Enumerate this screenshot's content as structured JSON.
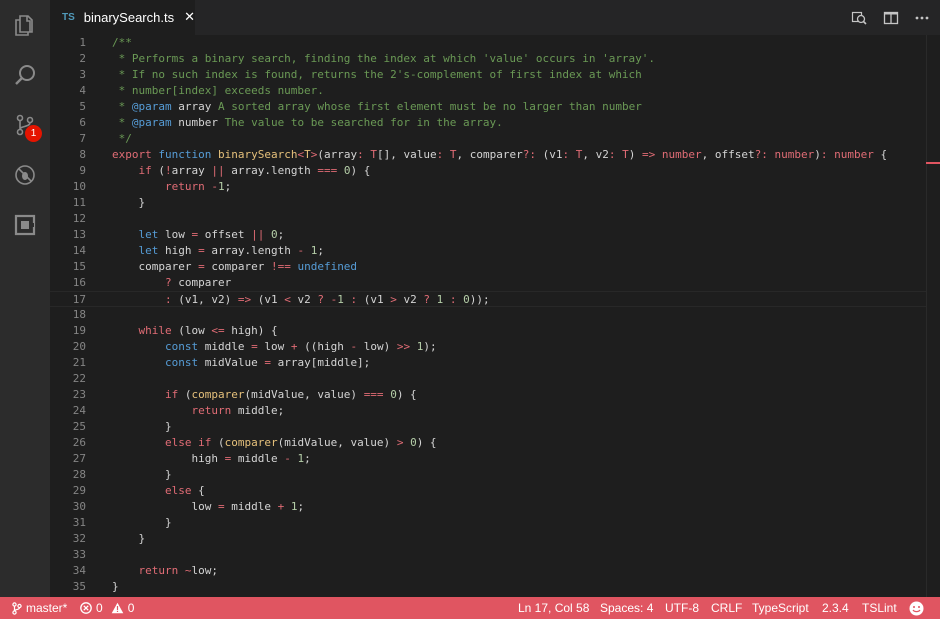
{
  "tab": {
    "lang_badge": "TS",
    "title": "binarySearch.ts",
    "close_glyph": "✕"
  },
  "activity_bar": {
    "icons": [
      "explorer-icon",
      "search-icon",
      "source-control-icon",
      "debug-icon",
      "extensions-icon"
    ],
    "scm_badge": "1"
  },
  "toolbar": {
    "icons": [
      "open-preview-icon",
      "split-editor-icon",
      "more-actions-icon"
    ]
  },
  "editor": {
    "current_line": 17,
    "lines": [
      {
        "n": "1",
        "t": [
          {
            "c": "c-com",
            "s": "/**"
          }
        ]
      },
      {
        "n": "2",
        "t": [
          {
            "c": "c-com",
            "s": " * Performs a binary search, finding the index at which 'value' occurs in 'array'."
          }
        ]
      },
      {
        "n": "3",
        "t": [
          {
            "c": "c-com",
            "s": " * If no such index is found, returns the 2's-complement of first index at which"
          }
        ]
      },
      {
        "n": "4",
        "t": [
          {
            "c": "c-com",
            "s": " * number[index] exceeds number."
          }
        ]
      },
      {
        "n": "5",
        "t": [
          {
            "c": "c-com",
            "s": " * "
          },
          {
            "c": "c-tag",
            "s": "@param"
          },
          {
            "c": "c-var",
            "s": " array"
          },
          {
            "c": "c-com",
            "s": " A sorted array whose first element must be no larger than number"
          }
        ]
      },
      {
        "n": "6",
        "t": [
          {
            "c": "c-com",
            "s": " * "
          },
          {
            "c": "c-tag",
            "s": "@param"
          },
          {
            "c": "c-var",
            "s": " number"
          },
          {
            "c": "c-com",
            "s": " The value to be searched for in the array."
          }
        ]
      },
      {
        "n": "7",
        "t": [
          {
            "c": "c-com",
            "s": " */"
          }
        ]
      },
      {
        "n": "8",
        "t": [
          {
            "c": "c-kw",
            "s": "export"
          },
          {
            "c": "c-var",
            "s": " "
          },
          {
            "c": "c-kw2",
            "s": "function"
          },
          {
            "c": "c-var",
            "s": " "
          },
          {
            "c": "c-fn",
            "s": "binarySearch"
          },
          {
            "c": "c-op",
            "s": "<"
          },
          {
            "c": "c-fn",
            "s": "T"
          },
          {
            "c": "c-op",
            "s": ">"
          },
          {
            "c": "c-var",
            "s": "("
          },
          {
            "c": "c-var",
            "s": "array"
          },
          {
            "c": "c-op",
            "s": ":"
          },
          {
            "c": "c-var",
            "s": " "
          },
          {
            "c": "c-type",
            "s": "T"
          },
          {
            "c": "c-var",
            "s": "[], "
          },
          {
            "c": "c-var",
            "s": "value"
          },
          {
            "c": "c-op",
            "s": ":"
          },
          {
            "c": "c-var",
            "s": " "
          },
          {
            "c": "c-type",
            "s": "T"
          },
          {
            "c": "c-var",
            "s": ", "
          },
          {
            "c": "c-var",
            "s": "comparer"
          },
          {
            "c": "c-op",
            "s": "?:"
          },
          {
            "c": "c-var",
            "s": " ("
          },
          {
            "c": "c-var",
            "s": "v1"
          },
          {
            "c": "c-op",
            "s": ":"
          },
          {
            "c": "c-var",
            "s": " "
          },
          {
            "c": "c-type",
            "s": "T"
          },
          {
            "c": "c-var",
            "s": ", "
          },
          {
            "c": "c-var",
            "s": "v2"
          },
          {
            "c": "c-op",
            "s": ":"
          },
          {
            "c": "c-var",
            "s": " "
          },
          {
            "c": "c-type",
            "s": "T"
          },
          {
            "c": "c-var",
            "s": ") "
          },
          {
            "c": "c-op",
            "s": "=>"
          },
          {
            "c": "c-var",
            "s": " "
          },
          {
            "c": "c-type",
            "s": "number"
          },
          {
            "c": "c-var",
            "s": ", "
          },
          {
            "c": "c-var",
            "s": "offset"
          },
          {
            "c": "c-op",
            "s": "?:"
          },
          {
            "c": "c-var",
            "s": " "
          },
          {
            "c": "c-type",
            "s": "number"
          },
          {
            "c": "c-var",
            "s": ")"
          },
          {
            "c": "c-op",
            "s": ":"
          },
          {
            "c": "c-var",
            "s": " "
          },
          {
            "c": "c-type",
            "s": "number"
          },
          {
            "c": "c-var",
            "s": " {"
          }
        ]
      },
      {
        "n": "9",
        "t": [
          {
            "c": "c-var",
            "s": "    "
          },
          {
            "c": "c-kw",
            "s": "if"
          },
          {
            "c": "c-var",
            "s": " ("
          },
          {
            "c": "c-op",
            "s": "!"
          },
          {
            "c": "c-var",
            "s": "array "
          },
          {
            "c": "c-op",
            "s": "||"
          },
          {
            "c": "c-var",
            "s": " array.length "
          },
          {
            "c": "c-op",
            "s": "==="
          },
          {
            "c": "c-var",
            "s": " "
          },
          {
            "c": "c-num",
            "s": "0"
          },
          {
            "c": "c-var",
            "s": ") {"
          }
        ]
      },
      {
        "n": "10",
        "t": [
          {
            "c": "c-var",
            "s": "        "
          },
          {
            "c": "c-kw",
            "s": "return"
          },
          {
            "c": "c-var",
            "s": " "
          },
          {
            "c": "c-op",
            "s": "-"
          },
          {
            "c": "c-num",
            "s": "1"
          },
          {
            "c": "c-var",
            "s": ";"
          }
        ]
      },
      {
        "n": "11",
        "t": [
          {
            "c": "c-var",
            "s": "    }"
          }
        ]
      },
      {
        "n": "12",
        "t": []
      },
      {
        "n": "13",
        "t": [
          {
            "c": "c-var",
            "s": "    "
          },
          {
            "c": "c-kw2",
            "s": "let"
          },
          {
            "c": "c-var",
            "s": " low "
          },
          {
            "c": "c-op",
            "s": "="
          },
          {
            "c": "c-var",
            "s": " offset "
          },
          {
            "c": "c-op",
            "s": "||"
          },
          {
            "c": "c-var",
            "s": " "
          },
          {
            "c": "c-num",
            "s": "0"
          },
          {
            "c": "c-var",
            "s": ";"
          }
        ]
      },
      {
        "n": "14",
        "t": [
          {
            "c": "c-var",
            "s": "    "
          },
          {
            "c": "c-kw2",
            "s": "let"
          },
          {
            "c": "c-var",
            "s": " high "
          },
          {
            "c": "c-op",
            "s": "="
          },
          {
            "c": "c-var",
            "s": " array.length "
          },
          {
            "c": "c-op",
            "s": "-"
          },
          {
            "c": "c-var",
            "s": " "
          },
          {
            "c": "c-num",
            "s": "1"
          },
          {
            "c": "c-var",
            "s": ";"
          }
        ]
      },
      {
        "n": "15",
        "t": [
          {
            "c": "c-var",
            "s": "    comparer "
          },
          {
            "c": "c-op",
            "s": "="
          },
          {
            "c": "c-var",
            "s": " comparer "
          },
          {
            "c": "c-op",
            "s": "!=="
          },
          {
            "c": "c-var",
            "s": " "
          },
          {
            "c": "c-kw2",
            "s": "undefined"
          }
        ]
      },
      {
        "n": "16",
        "t": [
          {
            "c": "c-var",
            "s": "        "
          },
          {
            "c": "c-op",
            "s": "?"
          },
          {
            "c": "c-var",
            "s": " comparer"
          }
        ]
      },
      {
        "n": "17",
        "t": [
          {
            "c": "c-var",
            "s": "        "
          },
          {
            "c": "c-op",
            "s": ":"
          },
          {
            "c": "c-var",
            "s": " (v1, v2) "
          },
          {
            "c": "c-op",
            "s": "=>"
          },
          {
            "c": "c-var",
            "s": " (v1 "
          },
          {
            "c": "c-op",
            "s": "<"
          },
          {
            "c": "c-var",
            "s": " v2 "
          },
          {
            "c": "c-op",
            "s": "?"
          },
          {
            "c": "c-var",
            "s": " "
          },
          {
            "c": "c-op",
            "s": "-"
          },
          {
            "c": "c-num",
            "s": "1"
          },
          {
            "c": "c-var",
            "s": " "
          },
          {
            "c": "c-op",
            "s": ":"
          },
          {
            "c": "c-var",
            "s": " (v1 "
          },
          {
            "c": "c-op",
            "s": ">"
          },
          {
            "c": "c-var",
            "s": " v2 "
          },
          {
            "c": "c-op",
            "s": "?"
          },
          {
            "c": "c-var",
            "s": " "
          },
          {
            "c": "c-num",
            "s": "1"
          },
          {
            "c": "c-var",
            "s": " "
          },
          {
            "c": "c-op",
            "s": ":"
          },
          {
            "c": "c-var",
            "s": " "
          },
          {
            "c": "c-num",
            "s": "0"
          },
          {
            "c": "c-var",
            "s": "));"
          }
        ]
      },
      {
        "n": "18",
        "t": []
      },
      {
        "n": "19",
        "t": [
          {
            "c": "c-var",
            "s": "    "
          },
          {
            "c": "c-kw",
            "s": "while"
          },
          {
            "c": "c-var",
            "s": " (low "
          },
          {
            "c": "c-op",
            "s": "<="
          },
          {
            "c": "c-var",
            "s": " high) {"
          }
        ]
      },
      {
        "n": "20",
        "t": [
          {
            "c": "c-var",
            "s": "        "
          },
          {
            "c": "c-kw2",
            "s": "const"
          },
          {
            "c": "c-var",
            "s": " middle "
          },
          {
            "c": "c-op",
            "s": "="
          },
          {
            "c": "c-var",
            "s": " low "
          },
          {
            "c": "c-op",
            "s": "+"
          },
          {
            "c": "c-var",
            "s": " ((high "
          },
          {
            "c": "c-op",
            "s": "-"
          },
          {
            "c": "c-var",
            "s": " low) "
          },
          {
            "c": "c-op",
            "s": ">>"
          },
          {
            "c": "c-var",
            "s": " "
          },
          {
            "c": "c-num",
            "s": "1"
          },
          {
            "c": "c-var",
            "s": ");"
          }
        ]
      },
      {
        "n": "21",
        "t": [
          {
            "c": "c-var",
            "s": "        "
          },
          {
            "c": "c-kw2",
            "s": "const"
          },
          {
            "c": "c-var",
            "s": " midValue "
          },
          {
            "c": "c-op",
            "s": "="
          },
          {
            "c": "c-var",
            "s": " array[middle];"
          }
        ]
      },
      {
        "n": "22",
        "t": []
      },
      {
        "n": "23",
        "t": [
          {
            "c": "c-var",
            "s": "        "
          },
          {
            "c": "c-kw",
            "s": "if"
          },
          {
            "c": "c-var",
            "s": " ("
          },
          {
            "c": "c-fn",
            "s": "comparer"
          },
          {
            "c": "c-var",
            "s": "(midValue, value) "
          },
          {
            "c": "c-op",
            "s": "==="
          },
          {
            "c": "c-var",
            "s": " "
          },
          {
            "c": "c-num",
            "s": "0"
          },
          {
            "c": "c-var",
            "s": ") {"
          }
        ]
      },
      {
        "n": "24",
        "t": [
          {
            "c": "c-var",
            "s": "            "
          },
          {
            "c": "c-kw",
            "s": "return"
          },
          {
            "c": "c-var",
            "s": " middle;"
          }
        ]
      },
      {
        "n": "25",
        "t": [
          {
            "c": "c-var",
            "s": "        }"
          }
        ]
      },
      {
        "n": "26",
        "t": [
          {
            "c": "c-var",
            "s": "        "
          },
          {
            "c": "c-kw",
            "s": "else"
          },
          {
            "c": "c-var",
            "s": " "
          },
          {
            "c": "c-kw",
            "s": "if"
          },
          {
            "c": "c-var",
            "s": " ("
          },
          {
            "c": "c-fn",
            "s": "comparer"
          },
          {
            "c": "c-var",
            "s": "(midValue, value) "
          },
          {
            "c": "c-op",
            "s": ">"
          },
          {
            "c": "c-var",
            "s": " "
          },
          {
            "c": "c-num",
            "s": "0"
          },
          {
            "c": "c-var",
            "s": ") {"
          }
        ]
      },
      {
        "n": "27",
        "t": [
          {
            "c": "c-var",
            "s": "            high "
          },
          {
            "c": "c-op",
            "s": "="
          },
          {
            "c": "c-var",
            "s": " middle "
          },
          {
            "c": "c-op",
            "s": "-"
          },
          {
            "c": "c-var",
            "s": " "
          },
          {
            "c": "c-num",
            "s": "1"
          },
          {
            "c": "c-var",
            "s": ";"
          }
        ]
      },
      {
        "n": "28",
        "t": [
          {
            "c": "c-var",
            "s": "        }"
          }
        ]
      },
      {
        "n": "29",
        "t": [
          {
            "c": "c-var",
            "s": "        "
          },
          {
            "c": "c-kw",
            "s": "else"
          },
          {
            "c": "c-var",
            "s": " {"
          }
        ]
      },
      {
        "n": "30",
        "t": [
          {
            "c": "c-var",
            "s": "            low "
          },
          {
            "c": "c-op",
            "s": "="
          },
          {
            "c": "c-var",
            "s": " middle "
          },
          {
            "c": "c-op",
            "s": "+"
          },
          {
            "c": "c-var",
            "s": " "
          },
          {
            "c": "c-num",
            "s": "1"
          },
          {
            "c": "c-var",
            "s": ";"
          }
        ]
      },
      {
        "n": "31",
        "t": [
          {
            "c": "c-var",
            "s": "        }"
          }
        ]
      },
      {
        "n": "32",
        "t": [
          {
            "c": "c-var",
            "s": "    }"
          }
        ]
      },
      {
        "n": "33",
        "t": []
      },
      {
        "n": "34",
        "t": [
          {
            "c": "c-var",
            "s": "    "
          },
          {
            "c": "c-kw",
            "s": "return"
          },
          {
            "c": "c-var",
            "s": " "
          },
          {
            "c": "c-op",
            "s": "~"
          },
          {
            "c": "c-var",
            "s": "low;"
          }
        ]
      },
      {
        "n": "35",
        "t": [
          {
            "c": "c-var",
            "s": "}"
          }
        ]
      }
    ]
  },
  "status_bar": {
    "branch": "master*",
    "errors": "0",
    "warnings": "0",
    "position": "Ln 17, Col 58",
    "spaces": "Spaces: 4",
    "encoding": "UTF-8",
    "eol": "CRLF",
    "language": "TypeScript",
    "ts_version": "2.3.4",
    "linter": "TSLint"
  },
  "colors": {
    "status_bar": "#e05561",
    "badge": "#e51400",
    "editor_bg": "#1e1e1e",
    "activity_bg": "#2c2c2c"
  }
}
